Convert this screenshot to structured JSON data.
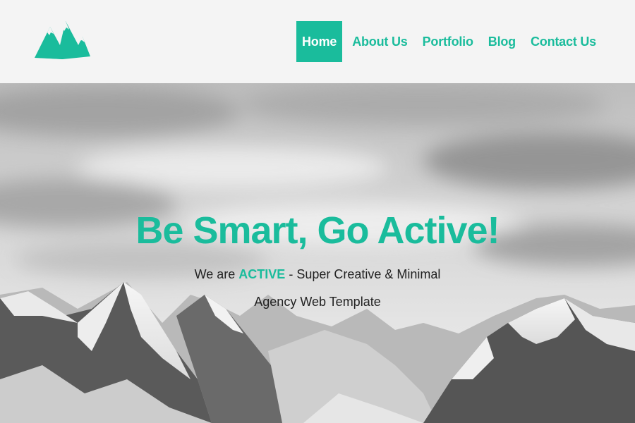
{
  "colors": {
    "accent": "#1abc9c",
    "header_bg": "#f4f4f4",
    "text": "#222222"
  },
  "logo": {
    "icon": "mountain-logo-icon"
  },
  "nav": {
    "items": [
      {
        "label": "Home",
        "active": true
      },
      {
        "label": "About Us",
        "active": false
      },
      {
        "label": "Portfolio",
        "active": false
      },
      {
        "label": "Blog",
        "active": false
      },
      {
        "label": "Contact Us",
        "active": false
      }
    ]
  },
  "hero": {
    "title": "Be Smart, Go Active!",
    "subtitle_prefix": "We are",
    "subtitle_brand": "ACTIVE",
    "subtitle_suffix": "- Super Creative & Minimal",
    "subtitle_line2": "Agency Web Template"
  }
}
